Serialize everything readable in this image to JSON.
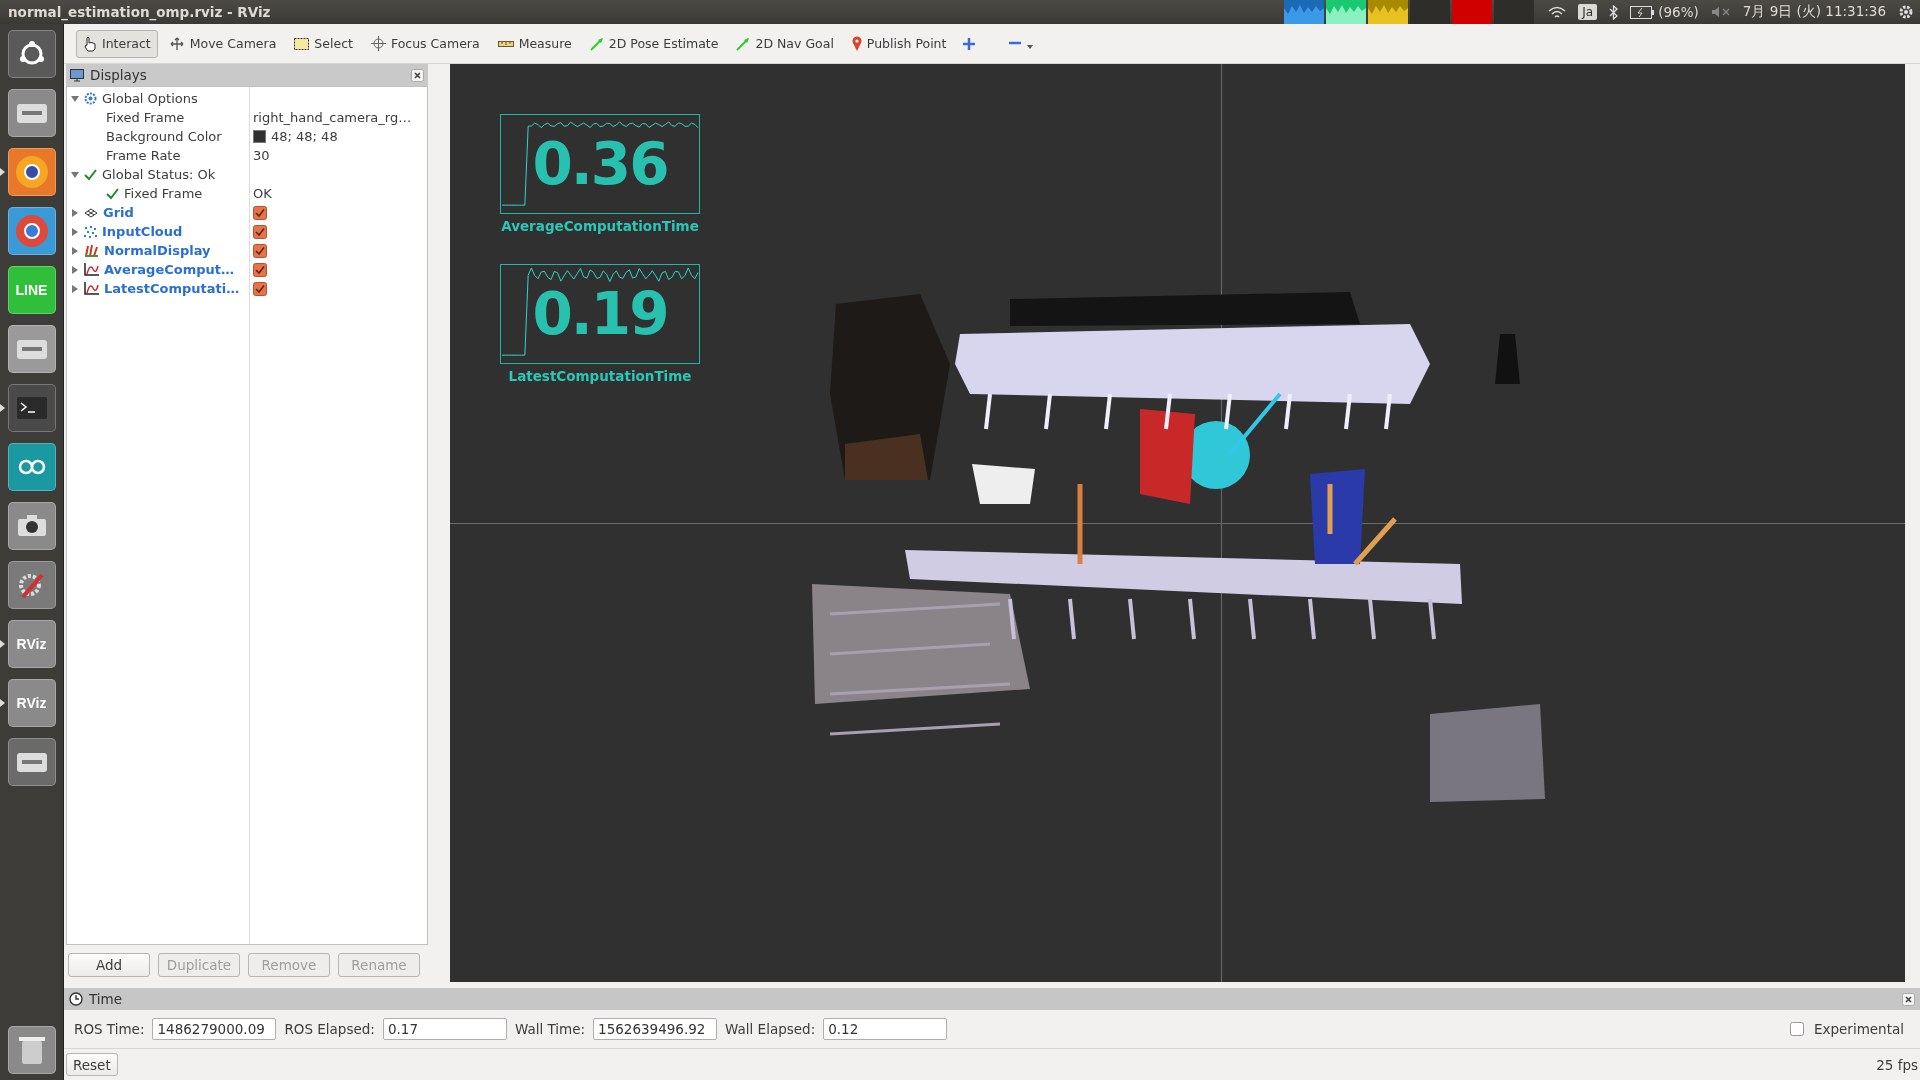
{
  "top_bar": {
    "title": "normal_estimation_omp.rviz - RViz",
    "input_method": "Ja",
    "battery": "(96%)",
    "clock": "7月 9日 (火) 11:31:36"
  },
  "launcher": [
    {
      "kind": "dash",
      "running": false
    },
    {
      "kind": "files",
      "running": false
    },
    {
      "kind": "firefox",
      "running": true
    },
    {
      "kind": "chrome",
      "running": false
    },
    {
      "kind": "line",
      "label": "LINE",
      "running": false
    },
    {
      "kind": "disk",
      "running": false
    },
    {
      "kind": "terminal",
      "running": true
    },
    {
      "kind": "arduino",
      "running": false
    },
    {
      "kind": "camera",
      "running": false
    },
    {
      "kind": "settings",
      "running": false
    },
    {
      "kind": "rviz",
      "label": "RViz",
      "running": true
    },
    {
      "kind": "rviz",
      "label": "RViz",
      "running": true
    },
    {
      "kind": "workspaces",
      "running": false
    },
    {
      "kind": "trash",
      "running": false
    }
  ],
  "toolbar": [
    {
      "kind": "interact",
      "label": "Interact",
      "selected": true
    },
    {
      "kind": "move",
      "label": "Move Camera",
      "selected": false
    },
    {
      "kind": "select",
      "label": "Select",
      "selected": false
    },
    {
      "kind": "focus",
      "label": "Focus Camera",
      "selected": false
    },
    {
      "kind": "measure",
      "label": "Measure",
      "selected": false
    },
    {
      "kind": "pose",
      "label": "2D Pose Estimate",
      "selected": false
    },
    {
      "kind": "goal",
      "label": "2D Nav Goal",
      "selected": false
    },
    {
      "kind": "point",
      "label": "Publish Point",
      "selected": false
    }
  ],
  "displays": {
    "title": "Displays",
    "tree": [
      {
        "kind": "options",
        "name": "Global Options",
        "expanded": true,
        "children": [
          {
            "kind": "property",
            "name": "Fixed Frame",
            "value": "right_hand_camera_rg…"
          },
          {
            "kind": "property",
            "name": "Background Color",
            "value": "48; 48; 48",
            "color": "#303030"
          },
          {
            "kind": "property",
            "name": "Frame Rate",
            "value": "30"
          }
        ]
      },
      {
        "kind": "status",
        "name": "Global Status: Ok",
        "expanded": true,
        "children": [
          {
            "kind": "status",
            "name": "Fixed Frame",
            "value": "OK"
          }
        ]
      },
      {
        "kind": "grid",
        "name": "Grid",
        "expanded": false,
        "checked": true
      },
      {
        "kind": "pointcloud",
        "name": "InputCloud",
        "expanded": false,
        "checked": true
      },
      {
        "kind": "normals",
        "name": "NormalDisplay",
        "expanded": false,
        "checked": true
      },
      {
        "kind": "plot",
        "name": "AverageComput…",
        "expanded": false,
        "checked": true
      },
      {
        "kind": "plot",
        "name": "LatestComputati…",
        "expanded": false,
        "checked": true
      }
    ],
    "buttons": [
      {
        "label": "Add",
        "disabled": false
      },
      {
        "label": "Duplicate",
        "disabled": true
      },
      {
        "label": "Remove",
        "disabled": true
      },
      {
        "label": "Rename",
        "disabled": true
      }
    ]
  },
  "viewport": {
    "overlays": [
      {
        "value": "0.36",
        "label": "AverageComputationTime"
      },
      {
        "value": "0.19",
        "label": "LatestComputationTime"
      }
    ]
  },
  "time_panel": {
    "title": "Time",
    "fields": [
      {
        "label": "ROS Time:",
        "value": "1486279000.09"
      },
      {
        "label": "ROS Elapsed:",
        "value": "0.17"
      },
      {
        "label": "Wall Time:",
        "value": "1562639496.92"
      },
      {
        "label": "Wall Elapsed:",
        "value": "0.12"
      }
    ],
    "experimental": {
      "label": "Experimental",
      "checked": false
    },
    "reset": "Reset",
    "fps": "25 fps"
  }
}
